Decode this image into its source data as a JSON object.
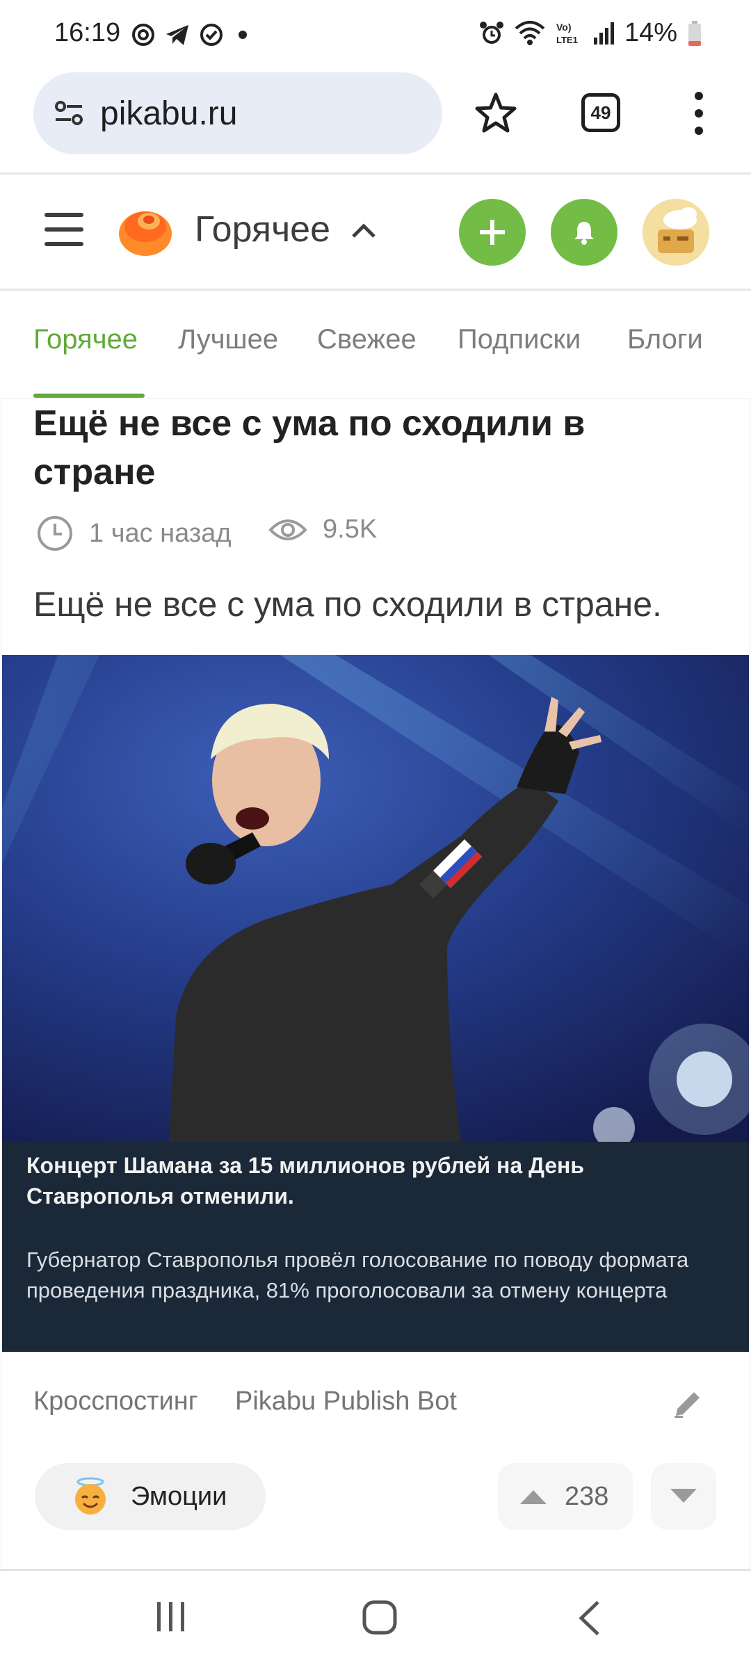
{
  "status_bar": {
    "time": "16:19",
    "battery": "14%",
    "left_icons": [
      "focus-icon",
      "telegram-icon",
      "check-circle-icon",
      "dot-icon"
    ],
    "right_icons": [
      "alarm-icon",
      "wifi-icon",
      "volte-icon",
      "signal-icon",
      "battery-icon"
    ],
    "volte_text": "Vo)\nLTE1"
  },
  "browser": {
    "url": "pikabu.ru",
    "tab_count": "49"
  },
  "header": {
    "section_title": "Горячее"
  },
  "tabs": [
    {
      "label": "Горячее",
      "active": true
    },
    {
      "label": "Лучшее",
      "active": false
    },
    {
      "label": "Свежее",
      "active": false
    },
    {
      "label": "Подписки",
      "active": false
    },
    {
      "label": "Блоги",
      "active": false
    }
  ],
  "post": {
    "title": "Ещё не все с ума по сходили в стране",
    "time_ago": "1 час назад",
    "views": "9.5K",
    "text": "Ещё не все с ума по сходили в стране.",
    "image_caption_title": "Концерт Шамана за 15 миллионов рублей на День Ставрополья отменили.",
    "image_caption_body": "Губернатор Ставрополья провёл голосование по поводу формата проведения праздника, 81% проголосовали за отмену концерта",
    "crosspost_label": "Кросспостинг",
    "author": "Pikabu Publish Bot",
    "emotions_label": "Эмоции",
    "rating": "238"
  },
  "colors": {
    "accent_green": "#73bd46",
    "tab_active": "#61a93a",
    "url_pill_bg": "#e7ecf7",
    "caption_bg": "#1b2838"
  }
}
